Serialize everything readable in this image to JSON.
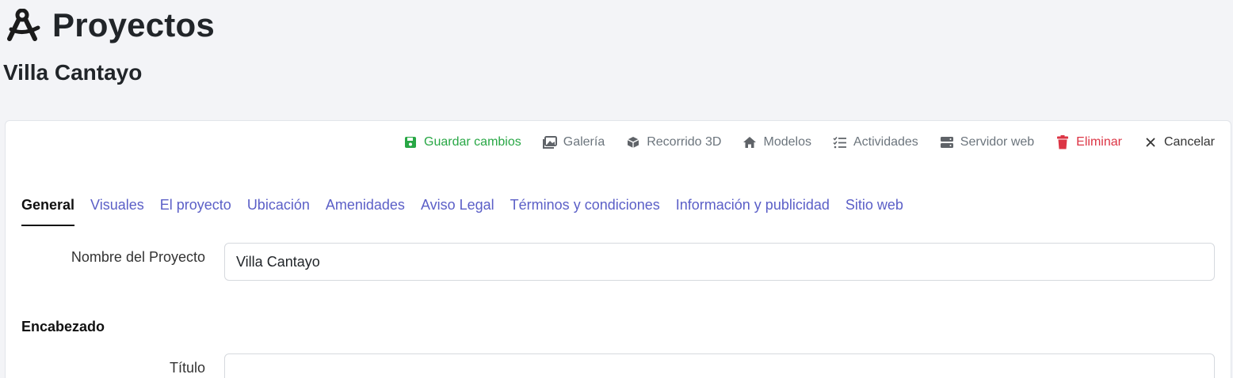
{
  "header": {
    "title": "Proyectos",
    "subtitle": "Villa Cantayo",
    "logo_icon": "compass-drafting-icon"
  },
  "toolbar": {
    "save_label": "Guardar cambios",
    "gallery_label": "Galería",
    "tour_label": "Recorrido 3D",
    "models_label": "Modelos",
    "activities_label": "Actividades",
    "server_label": "Servidor web",
    "delete_label": "Eliminar",
    "cancel_label": "Cancelar"
  },
  "tabs": [
    {
      "label": "General",
      "active": true
    },
    {
      "label": "Visuales"
    },
    {
      "label": "El proyecto"
    },
    {
      "label": "Ubicación"
    },
    {
      "label": "Amenidades"
    },
    {
      "label": "Aviso Legal"
    },
    {
      "label": "Términos y condiciones"
    },
    {
      "label": "Información y publicidad"
    },
    {
      "label": "Sitio web"
    }
  ],
  "form": {
    "nombre_label": "Nombre del Proyecto",
    "nombre_value": "Villa Cantayo",
    "encabezado_heading": "Encabezado",
    "titulo_label": "Título",
    "titulo_value": ""
  },
  "colors": {
    "background": "#f3f4f7",
    "tab_link": "#5b5fc7",
    "save": "#28a745",
    "delete": "#dc3545",
    "muted": "#6c757d"
  }
}
